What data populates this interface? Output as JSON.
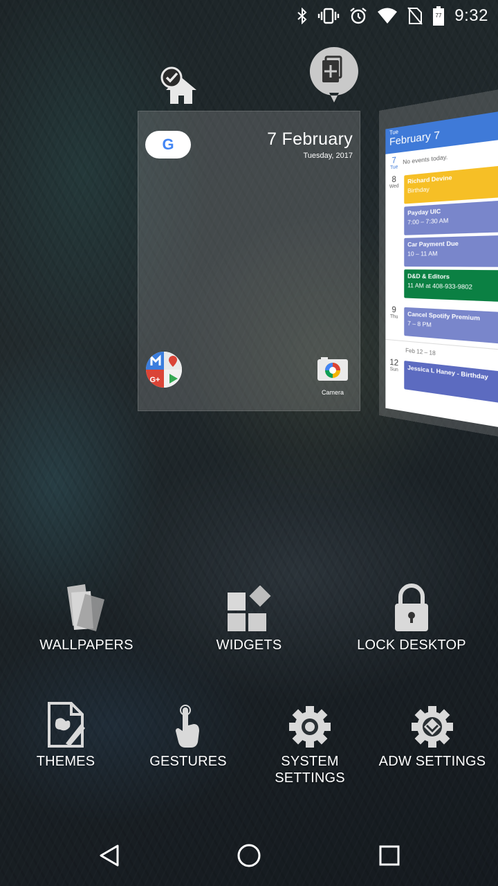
{
  "status_bar": {
    "time": "9:32",
    "battery_level": "77",
    "icons": [
      "bluetooth-icon",
      "vibrate-icon",
      "alarm-icon",
      "wifi-icon",
      "no-sim-icon",
      "battery-icon"
    ]
  },
  "top_actions": {
    "set_home_icon": "home-check-icon",
    "add_page_icon": "add-page-icon"
  },
  "preview": {
    "date": "7 February",
    "day": "Tuesday, 2017",
    "google_letter": "G",
    "camera_label": "Camera"
  },
  "calendar": {
    "header_small": "Tue",
    "header_big": "February 7",
    "rows": [
      {
        "day": "7",
        "weekday": "Tue",
        "note": "No events today."
      },
      {
        "day": "8",
        "weekday": "Wed"
      },
      {
        "day": "9",
        "weekday": "Thu"
      },
      {
        "day": "12",
        "weekday": "Sun"
      }
    ],
    "events_wed": [
      {
        "title": "Richard Devine",
        "detail": "Birthday",
        "color": "#f6bf26"
      },
      {
        "title": "Payday UIC",
        "detail": "7:00 – 7:30 AM",
        "color": "#7986cb"
      },
      {
        "title": "Car Payment Due",
        "detail": "10 – 11 AM",
        "color": "#7986cb"
      },
      {
        "title": "D&D & Editors",
        "detail": "11 AM at 408-933-9802",
        "color": "#0b8043"
      }
    ],
    "event_thu": {
      "title": "Cancel Spotify Premium",
      "detail": "7 – 8 PM"
    },
    "week_range": "Feb 12 – 18",
    "event_sun": {
      "title": "Jessica L Haney - Birthday"
    }
  },
  "menu": {
    "wallpapers": "WALLPAPERS",
    "widgets": "WIDGETS",
    "lock_desktop": "LOCK DESKTOP",
    "themes": "THEMES",
    "gestures": "GESTURES",
    "system_settings": "SYSTEM\nSETTINGS",
    "adw_settings": "ADW SETTINGS"
  },
  "navbar": {
    "back": "back-icon",
    "home": "home-icon",
    "recents": "recents-icon"
  }
}
